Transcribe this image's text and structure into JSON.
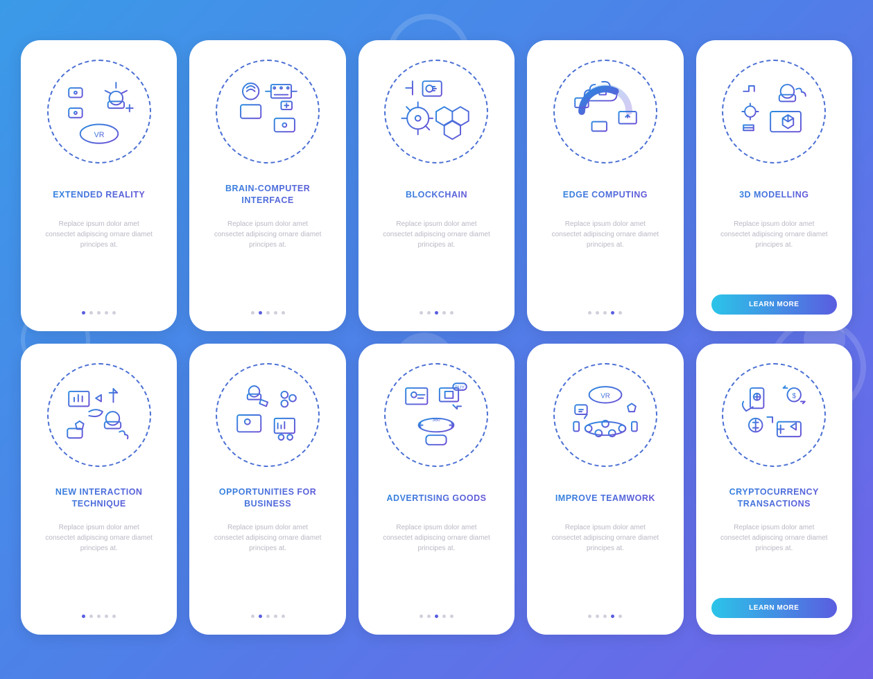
{
  "desc": "Replace ipsum dolor amet consectet adipiscing ornare diamet principes at.",
  "cta_label": "LEARN MORE",
  "rows": [
    {
      "screens": [
        {
          "title": "EXTENDED REALITY",
          "active": 0
        },
        {
          "title": "BRAIN-COMPUTER INTERFACE",
          "active": 1
        },
        {
          "title": "BLOCKCHAIN",
          "active": 2
        },
        {
          "title": "EDGE COMPUTING",
          "active": 3
        },
        {
          "title": "3D MODELLING",
          "active": 4,
          "cta": true
        }
      ]
    },
    {
      "screens": [
        {
          "title": "NEW INTERACTION TECHNIQUE",
          "active": 0
        },
        {
          "title": "OPPORTUNITIES FOR BUSINESS",
          "active": 1
        },
        {
          "title": "ADVERTISING GOODS",
          "active": 2
        },
        {
          "title": "IMPROVE TEAMWORK",
          "active": 3
        },
        {
          "title": "CRYPTOCURRENCY TRANSACTIONS",
          "active": 4,
          "cta": true
        }
      ]
    }
  ]
}
